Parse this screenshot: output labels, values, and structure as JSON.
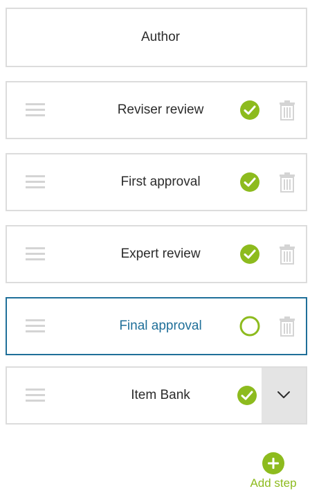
{
  "author": {
    "label": "Author"
  },
  "steps": [
    {
      "label": "Reviser review",
      "status": "complete",
      "action": "delete"
    },
    {
      "label": "First approval",
      "status": "complete",
      "action": "delete"
    },
    {
      "label": "Expert review",
      "status": "complete",
      "action": "delete"
    },
    {
      "label": "Final approval",
      "status": "incomplete",
      "action": "delete",
      "selected": true
    },
    {
      "label": "Item Bank",
      "status": "complete",
      "action": "expand"
    }
  ],
  "add_step": {
    "label": "Add step"
  },
  "colors": {
    "accent_green": "#8dbb1e",
    "selected_blue": "#1f6f99",
    "border_gray": "#dcdcdc",
    "icon_gray": "#d4d4d4"
  },
  "icons": {
    "drag": "drag-handle-icon",
    "complete": "check-circle-icon",
    "incomplete": "empty-circle-icon",
    "delete": "trash-icon",
    "expand": "chevron-down-icon",
    "add": "plus-circle-icon"
  }
}
